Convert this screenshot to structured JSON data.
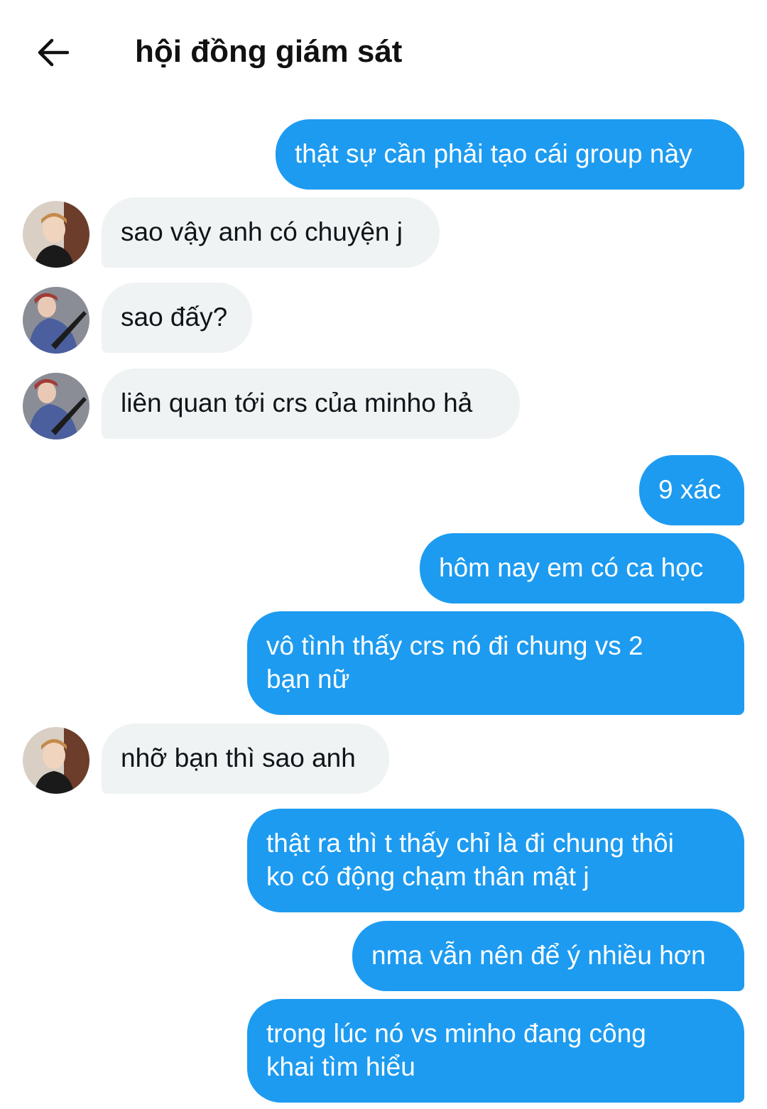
{
  "header": {
    "title": "hội đồng giám sát",
    "back_icon": "arrow-left-icon"
  },
  "colors": {
    "outgoing_bubble": "#1d9bf0",
    "incoming_bubble": "#eff3f4",
    "outgoing_text": "#ffffff",
    "incoming_text": "#0f1419"
  },
  "messages": [
    {
      "direction": "out",
      "text": "thật sự cần phải tạo cái group này"
    },
    {
      "direction": "in",
      "sender": "user-1",
      "text": "sao vậy anh có chuyện j"
    },
    {
      "direction": "in",
      "sender": "user-2",
      "text": "sao đấy?"
    },
    {
      "direction": "in",
      "sender": "user-2",
      "text": "liên quan tới crs của minho hả"
    },
    {
      "direction": "out",
      "text": "9 xác"
    },
    {
      "direction": "out",
      "text": "hôm nay em có ca học"
    },
    {
      "direction": "out",
      "text": "vô tình thấy crs nó đi chung vs 2\nbạn nữ"
    },
    {
      "direction": "in",
      "sender": "user-1",
      "text": "nhỡ bạn thì sao anh"
    },
    {
      "direction": "out",
      "text": "thật ra thì t thấy chỉ là đi chung thôi\nko có động chạm thân mật j"
    },
    {
      "direction": "out",
      "text": "nma vẫn nên để ý nhiều hơn"
    },
    {
      "direction": "out",
      "text": "trong lúc nó vs minho đang công\nkhai tìm hiểu"
    }
  ]
}
